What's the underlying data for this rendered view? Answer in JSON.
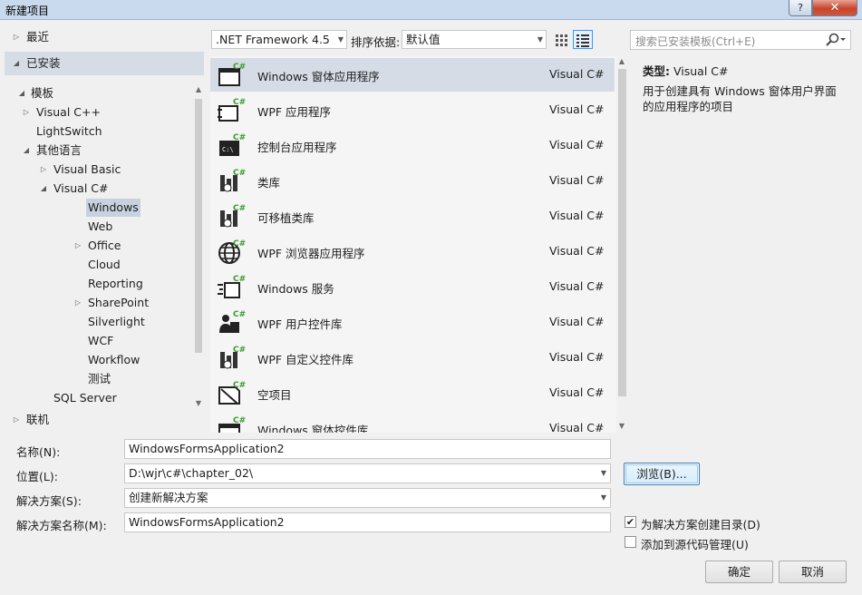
{
  "window": {
    "title": "新建项目",
    "help": "?",
    "close": "✕"
  },
  "tree": {
    "recent": "最近",
    "installed": "已安装",
    "templates": "模板",
    "items": [
      {
        "label": "Visual C++",
        "arrow": "▷"
      },
      {
        "label": "LightSwitch",
        "arrow": ""
      },
      {
        "label": "其他语言",
        "arrow": "◢"
      },
      {
        "label": "Visual Basic",
        "arrow": "▷"
      },
      {
        "label": "Visual C#",
        "arrow": "◢"
      },
      {
        "label": "Windows",
        "arrow": ""
      },
      {
        "label": "Web",
        "arrow": ""
      },
      {
        "label": "Office",
        "arrow": "▷"
      },
      {
        "label": "Cloud",
        "arrow": ""
      },
      {
        "label": "Reporting",
        "arrow": ""
      },
      {
        "label": "SharePoint",
        "arrow": "▷"
      },
      {
        "label": "Silverlight",
        "arrow": ""
      },
      {
        "label": "WCF",
        "arrow": ""
      },
      {
        "label": "Workflow",
        "arrow": ""
      },
      {
        "label": "测试",
        "arrow": ""
      },
      {
        "label": "SQL Server",
        "arrow": ""
      }
    ],
    "online": "联机"
  },
  "toolbar": {
    "framework": ".NET Framework 4.5",
    "sort_label": "排序依据:",
    "sort_value": "默认值"
  },
  "search": {
    "placeholder": "搜索已安装模板(Ctrl+E)"
  },
  "templates": [
    {
      "name": "Windows 窗体应用程序",
      "lang": "Visual C#",
      "icon": "winforms-app-icon"
    },
    {
      "name": "WPF 应用程序",
      "lang": "Visual C#",
      "icon": "wpf-app-icon"
    },
    {
      "name": "控制台应用程序",
      "lang": "Visual C#",
      "icon": "console-app-icon"
    },
    {
      "name": "类库",
      "lang": "Visual C#",
      "icon": "class-library-icon"
    },
    {
      "name": "可移植类库",
      "lang": "Visual C#",
      "icon": "portable-library-icon"
    },
    {
      "name": "WPF 浏览器应用程序",
      "lang": "Visual C#",
      "icon": "wpf-browser-app-icon"
    },
    {
      "name": "Windows 服务",
      "lang": "Visual C#",
      "icon": "windows-service-icon"
    },
    {
      "name": "WPF 用户控件库",
      "lang": "Visual C#",
      "icon": "wpf-user-control-icon"
    },
    {
      "name": "WPF 自定义控件库",
      "lang": "Visual C#",
      "icon": "wpf-custom-control-icon"
    },
    {
      "name": "空项目",
      "lang": "Visual C#",
      "icon": "empty-project-icon"
    },
    {
      "name": "Windows 窗体控件库",
      "lang": "Visual C#",
      "icon": "winforms-control-icon"
    }
  ],
  "info": {
    "type_label": "类型:",
    "type_value": "Visual C#",
    "description": "用于创建具有 Windows 窗体用户界面的应用程序的项目"
  },
  "form": {
    "name_label": "名称(N):",
    "name_value": "WindowsFormsApplication2",
    "location_label": "位置(L):",
    "location_value": "D:\\wjr\\c#\\chapter_02\\",
    "solution_label": "解决方案(S):",
    "solution_value": "创建新解决方案",
    "solution_name_label": "解决方案名称(M):",
    "solution_name_value": "WindowsFormsApplication2",
    "browse": "浏览(B)...",
    "create_dir_label": "为解决方案创建目录(D)",
    "create_dir_checked": "✔",
    "source_control_label": "添加到源代码管理(U)",
    "ok": "确定",
    "cancel": "取消"
  }
}
